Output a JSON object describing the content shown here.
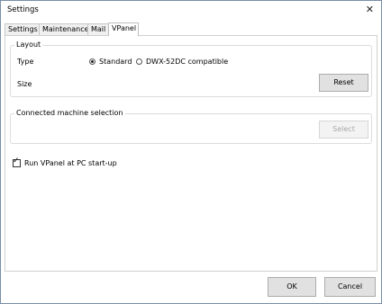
{
  "window": {
    "title": "Settings",
    "close_glyph": "✕"
  },
  "tabs": [
    {
      "label": "Settings",
      "active": false
    },
    {
      "label": "Maintenance",
      "active": false
    },
    {
      "label": "Mail",
      "active": false
    },
    {
      "label": "VPanel",
      "active": true
    }
  ],
  "layout_group": {
    "legend": "Layout",
    "type_label": "Type",
    "radio_options": [
      {
        "label": "Standard",
        "selected": true
      },
      {
        "label": "DWX-52DC compatible",
        "selected": false
      }
    ],
    "size_label": "Size",
    "reset_label": "Reset"
  },
  "machine_group": {
    "legend": "Connected machine selection",
    "select_label": "Select"
  },
  "startup_checkbox": {
    "label": "Run VPanel at PC start-up",
    "checked": true,
    "check_glyph": "✓"
  },
  "footer": {
    "ok_label": "OK",
    "cancel_label": "Cancel"
  }
}
